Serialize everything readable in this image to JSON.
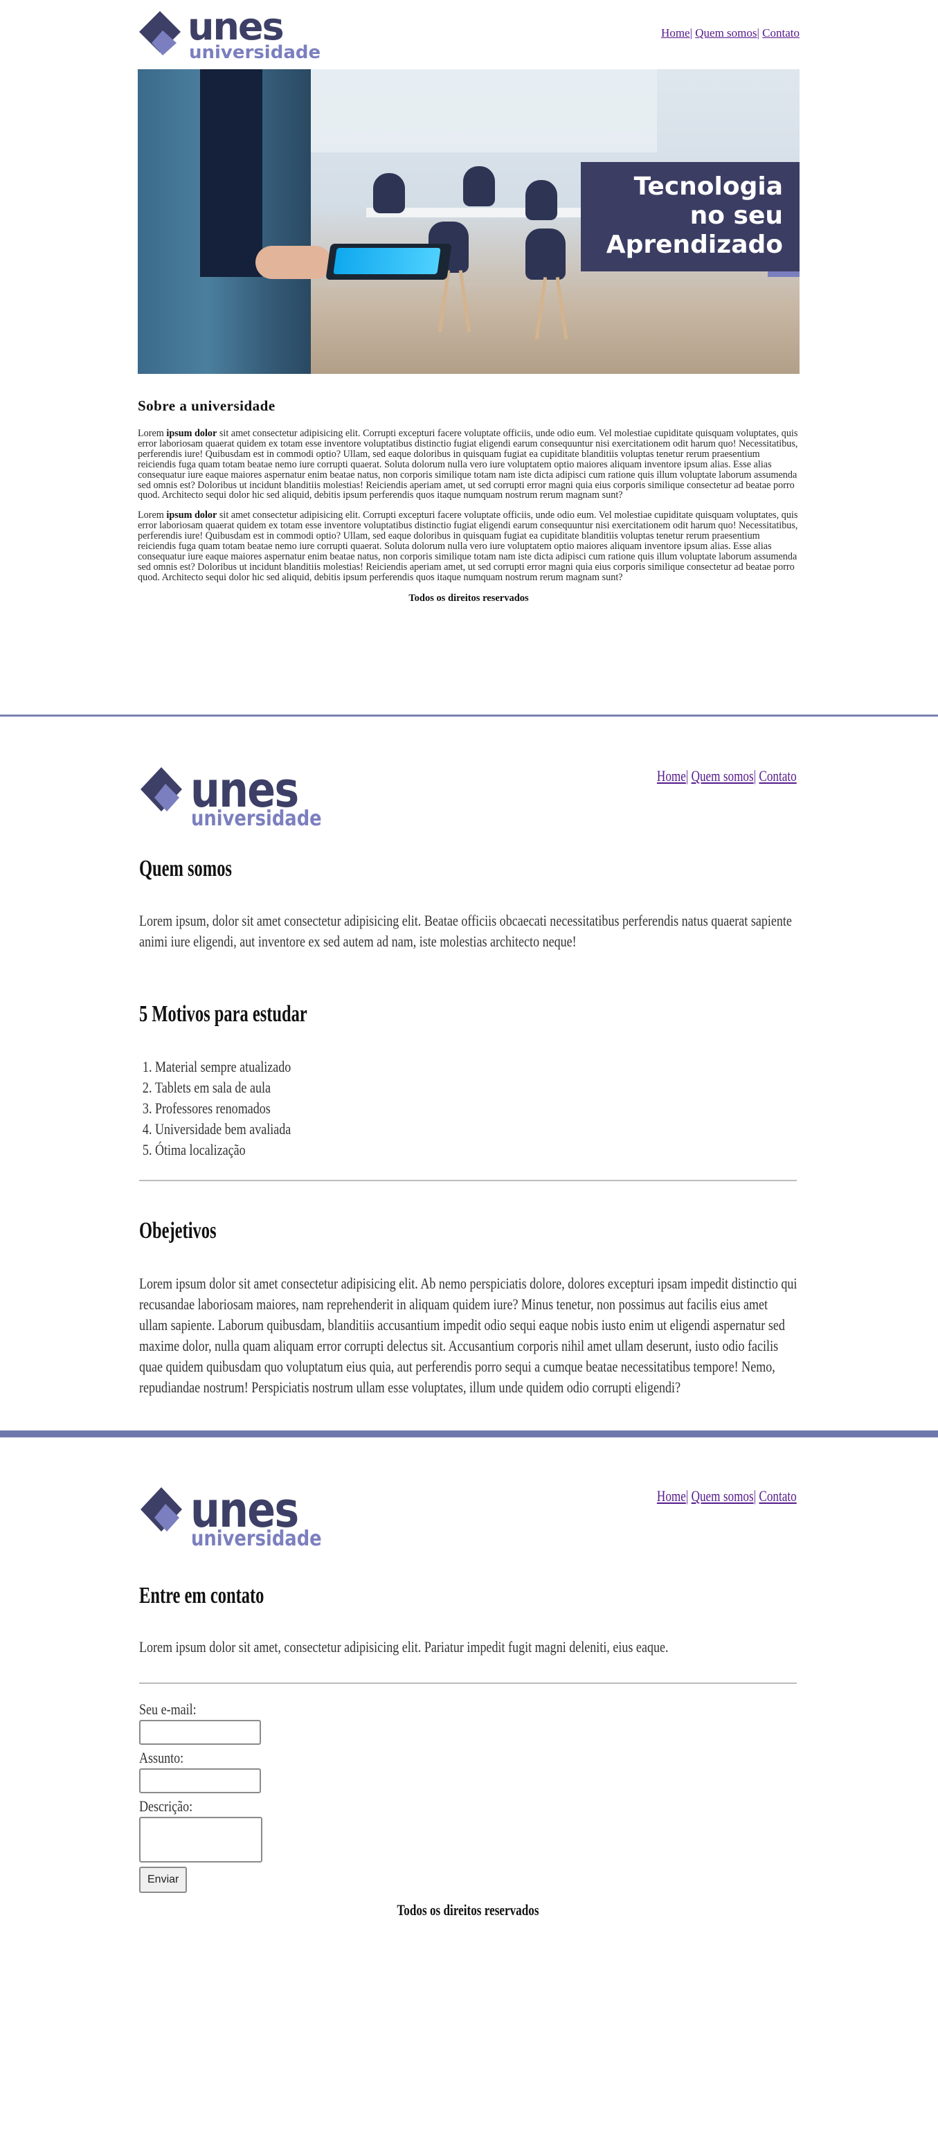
{
  "page1": {
    "logo": {
      "word": "unes",
      "sub": "universidade"
    },
    "nav": {
      "home": "Home",
      "about": "Quem somos",
      "contact": "Contato",
      "separator": "|"
    },
    "banner": {
      "line1": "Tecnologia",
      "line2": "no seu",
      "line3": "Aprendizado"
    },
    "section_title": "Sobre a universidade",
    "paragraph1": {
      "pre": "Lorem ",
      "bold": "ipsum dolor",
      "post": " sit amet consectetur adipisicing elit. Corrupti excepturi facere voluptate officiis, unde odio eum. Vel molestiae cupiditate quisquam voluptates, quis error laboriosam quaerat quidem ex totam esse inventore voluptatibus distinctio fugiat eligendi earum consequuntur nisi exercitationem odit harum quo! Necessitatibus, perferendis iure! Quibusdam est in commodi optio? Ullam, sed eaque doloribus in quisquam fugiat ea cupiditate blanditiis voluptas tenetur rerum praesentium reiciendis fuga quam totam beatae nemo iure corrupti quaerat. Soluta dolorum nulla vero iure voluptatem optio maiores aliquam inventore ipsum alias. Esse alias consequatur iure eaque maiores aspernatur enim beatae natus, non corporis similique totam nam iste dicta adipisci cum ratione quis illum voluptate laborum assumenda sed omnis est? Doloribus ut incidunt blanditiis molestias! Reiciendis aperiam amet, ut sed corrupti error magni quia eius corporis similique consectetur ad beatae porro quod. Architecto sequi dolor hic sed aliquid, debitis ipsum perferendis quos itaque numquam nostrum rerum magnam sunt?"
    },
    "paragraph2": {
      "pre": "Lorem ",
      "bold": "ipsum dolor",
      "post": " sit amet consectetur adipisicing elit. Corrupti excepturi facere voluptate officiis, unde odio eum. Vel molestiae cupiditate quisquam voluptates, quis error laboriosam quaerat quidem ex totam esse inventore voluptatibus distinctio fugiat eligendi earum consequuntur nisi exercitationem odit harum quo! Necessitatibus, perferendis iure! Quibusdam est in commodi optio? Ullam, sed eaque doloribus in quisquam fugiat ea cupiditate blanditiis voluptas tenetur rerum praesentium reiciendis fuga quam totam beatae nemo iure corrupti quaerat. Soluta dolorum nulla vero iure voluptatem optio maiores aliquam inventore ipsum alias. Esse alias consequatur iure eaque maiores aspernatur enim beatae natus, non corporis similique totam nam iste dicta adipisci cum ratione quis illum voluptate laborum assumenda sed omnis est? Doloribus ut incidunt blanditiis molestias! Reiciendis aperiam amet, ut sed corrupti error magni quia eius corporis similique consectetur ad beatae porro quod. Architecto sequi dolor hic sed aliquid, debitis ipsum perferendis quos itaque numquam nostrum rerum magnam sunt?"
    },
    "footer": "Todos os direitos reservados"
  },
  "page2": {
    "logo": {
      "word": "unes",
      "sub": "universidade"
    },
    "nav": {
      "home": "Home",
      "about": "Quem somos",
      "contact": "Contato",
      "separator": "|"
    },
    "about_title": "Quem somos",
    "about_text": "Lorem ipsum, dolor sit amet consectetur adipisicing elit. Beatae officiis obcaecati necessitatibus perferendis natus quaerat sapiente animi iure eligendi, aut inventore ex sed autem ad nam, iste molestias architecto neque!",
    "reasons_title": "5 Motivos para estudar",
    "reasons": [
      "Material sempre atualizado",
      "Tablets em sala de aula",
      "Professores renomados",
      "Universidade bem avaliada",
      "Ótima localização"
    ],
    "goals_title": "Obejetivos",
    "goals_text": "Lorem ipsum dolor sit amet consectetur adipisicing elit. Ab nemo perspiciatis dolore, dolores excepturi ipsam impedit distinctio qui recusandae laboriosam maiores, nam reprehenderit in aliquam quidem iure? Minus tenetur, non possimus aut facilis eius amet ullam sapiente. Laborum quibusdam, blanditiis accusantium impedit odio sequi eaque nobis iusto enim ut eligendi aspernatur sed maxime dolor, nulla quam aliquam error corrupti delectus sit. Accusantium corporis nihil amet ullam deserunt, iusto odio facilis quae quidem quibusdam quo voluptatum eius quia, aut perferendis porro sequi a cumque beatae necessitatibus tempore! Nemo, repudiandae nostrum! Perspiciatis nostrum ullam esse voluptates, illum unde quidem odio corrupti eligendi?"
  },
  "page3": {
    "logo": {
      "word": "unes",
      "sub": "universidade"
    },
    "nav": {
      "home": "Home",
      "about": "Quem somos",
      "contact": "Contato",
      "separator": "|"
    },
    "title": "Entre em contato",
    "intro": "Lorem ipsum dolor sit amet, consectetur adipisicing elit. Pariatur impedit fugit magni deleniti, eius eaque.",
    "form": {
      "email_label": "Seu e-mail:",
      "email_value": "",
      "subject_label": "Assunto:",
      "subject_value": "",
      "description_label": "Descrição:",
      "description_value": "",
      "submit": "Enviar"
    },
    "footer": "Todos os direitos reservados"
  },
  "colors": {
    "brand_dark": "#3d3f66",
    "brand_light": "#7b7fbf",
    "divider": "#6f78ac",
    "link": "#551a8b"
  }
}
